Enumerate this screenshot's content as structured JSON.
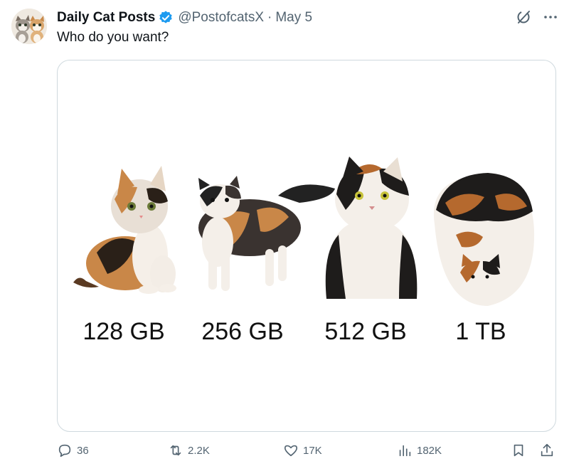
{
  "tweet": {
    "display_name": "Daily Cat Posts",
    "handle": "@PostofcatsX",
    "separator": "·",
    "date": "May 5",
    "text": "Who do you want?"
  },
  "media": {
    "labels": [
      "128 GB",
      "256 GB",
      "512 GB",
      "1 TB"
    ]
  },
  "actions": {
    "replies": "36",
    "reposts": "2.2K",
    "likes": "17K",
    "views": "182K"
  },
  "icons": {
    "verified": "verified-badge-icon",
    "grok": "grok-icon",
    "more": "more-icon",
    "reply": "reply-icon",
    "repost": "repost-icon",
    "like": "heart-icon",
    "views": "views-icon",
    "bookmark": "bookmark-icon",
    "share": "share-icon"
  },
  "colors": {
    "text_primary": "#0f1419",
    "text_secondary": "#536471",
    "verified_blue": "#1d9bf0",
    "border": "#cfd9de"
  }
}
